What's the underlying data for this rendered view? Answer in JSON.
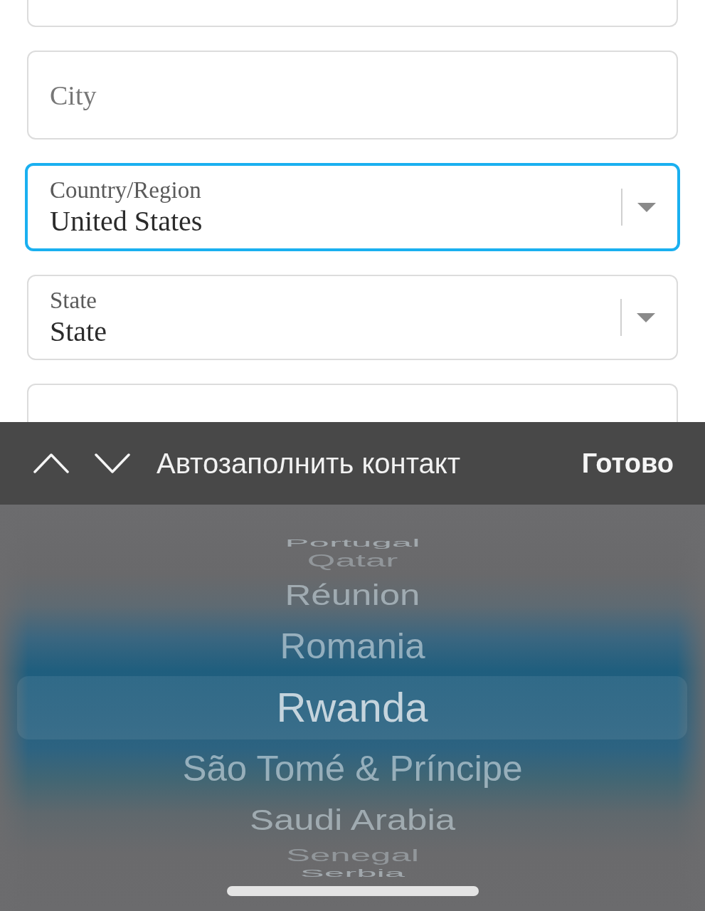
{
  "form": {
    "fields": [
      {
        "kind": "text",
        "focused": false
      },
      {
        "kind": "text",
        "placeholder": "City",
        "focused": false
      },
      {
        "kind": "select",
        "label": "Country/Region",
        "value": "United States",
        "focused": true
      },
      {
        "kind": "select",
        "label": "State",
        "value": "State",
        "focused": false
      },
      {
        "kind": "text",
        "focused": false
      }
    ]
  },
  "toolbar": {
    "autofill": "Автозаполнить контакт",
    "done": "Готово"
  },
  "picker": {
    "options": [
      {
        "label": "Portugal",
        "selected": false
      },
      {
        "label": "Qatar",
        "selected": false
      },
      {
        "label": "Réunion",
        "selected": false
      },
      {
        "label": "Romania",
        "selected": false
      },
      {
        "label": "Rwanda",
        "selected": true
      },
      {
        "label": "São Tomé & Príncipe",
        "selected": false
      },
      {
        "label": "Saudi Arabia",
        "selected": false
      },
      {
        "label": "Senegal",
        "selected": false
      },
      {
        "label": "Serbia",
        "selected": false
      }
    ]
  }
}
